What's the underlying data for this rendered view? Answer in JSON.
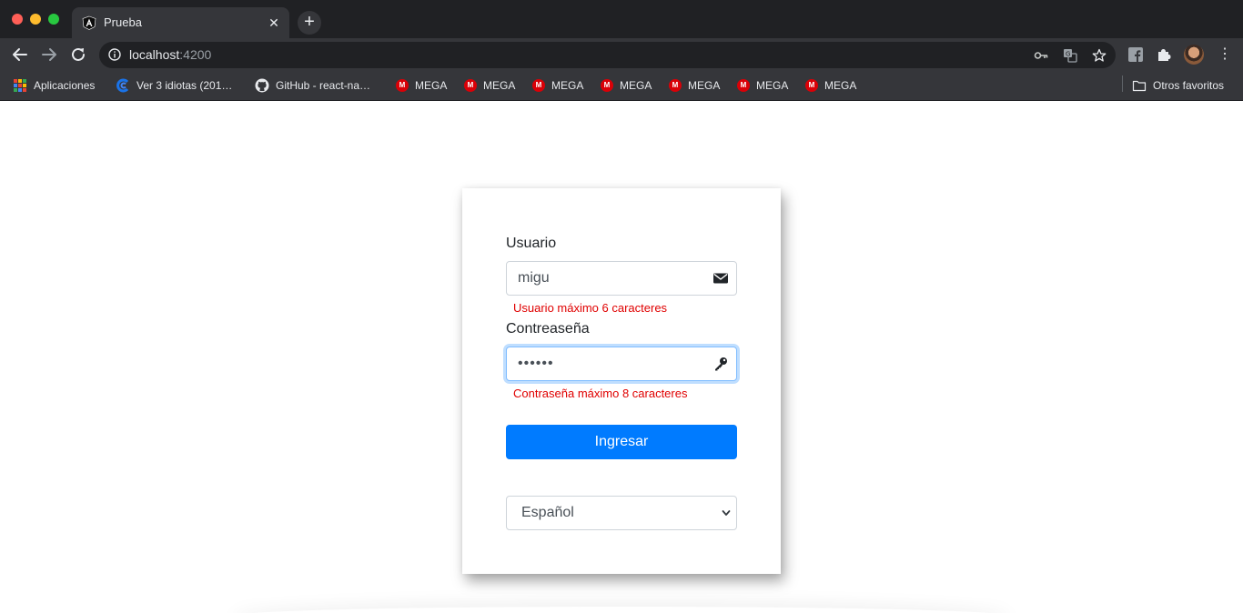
{
  "browser": {
    "tab": {
      "title": "Prueba"
    },
    "address": {
      "host": "localhost",
      "port": ":4200"
    },
    "bookmarks": [
      {
        "label": "Aplicaciones",
        "icon": "apps-grid-icon"
      },
      {
        "label": "Ver 3 idiotas (201…",
        "icon": "site-icon"
      },
      {
        "label": "GitHub - react-na…",
        "icon": "github-icon"
      },
      {
        "label": "MEGA",
        "icon": "mega-icon"
      },
      {
        "label": "MEGA",
        "icon": "mega-icon"
      },
      {
        "label": "MEGA",
        "icon": "mega-icon"
      },
      {
        "label": "MEGA",
        "icon": "mega-icon"
      },
      {
        "label": "MEGA",
        "icon": "mega-icon"
      },
      {
        "label": "MEGA",
        "icon": "mega-icon"
      },
      {
        "label": "MEGA",
        "icon": "mega-icon"
      }
    ],
    "other_bookmarks": "Otros favoritos"
  },
  "login": {
    "user_label": "Usuario",
    "user_value": "migu",
    "user_error": "Usuario máximo 6 caracteres",
    "password_label": "Contreaseña",
    "password_value": "••••••",
    "password_error": "Contraseña máximo 8 caracteres",
    "submit_label": "Ingresar",
    "language_selected": "Español"
  },
  "colors": {
    "primary": "#007bff",
    "error": "#e00000",
    "chrome_dark": "#202124",
    "chrome_toolbar": "#35363a"
  }
}
